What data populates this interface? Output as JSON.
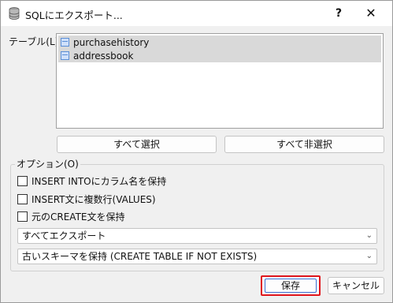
{
  "window": {
    "title": "SQLにエクスポート...",
    "help": "?",
    "close": "✕"
  },
  "tables": {
    "label": "テーブル(L)",
    "items": [
      "purchasehistory",
      "addressbook"
    ]
  },
  "buttons": {
    "select_all": "すべて選択",
    "deselect_all": "すべて非選択",
    "save": "保存",
    "cancel": "キャンセル"
  },
  "options": {
    "label": "オプション(O)",
    "checkboxes": [
      {
        "label": "INSERT INTOにカラム名を保持",
        "checked": false
      },
      {
        "label": "INSERT文に複数行(VALUES)",
        "checked": false
      },
      {
        "label": "元のCREATE文を保持",
        "checked": false
      }
    ],
    "export_mode": "すべてエクスポート",
    "schema_mode": "古いスキーマを保持 (CREATE TABLE IF NOT EXISTS)"
  },
  "colors": {
    "highlight_box": "#e0161c",
    "focus_ring": "#3a6fd1",
    "selection": "#d9d9d9"
  }
}
